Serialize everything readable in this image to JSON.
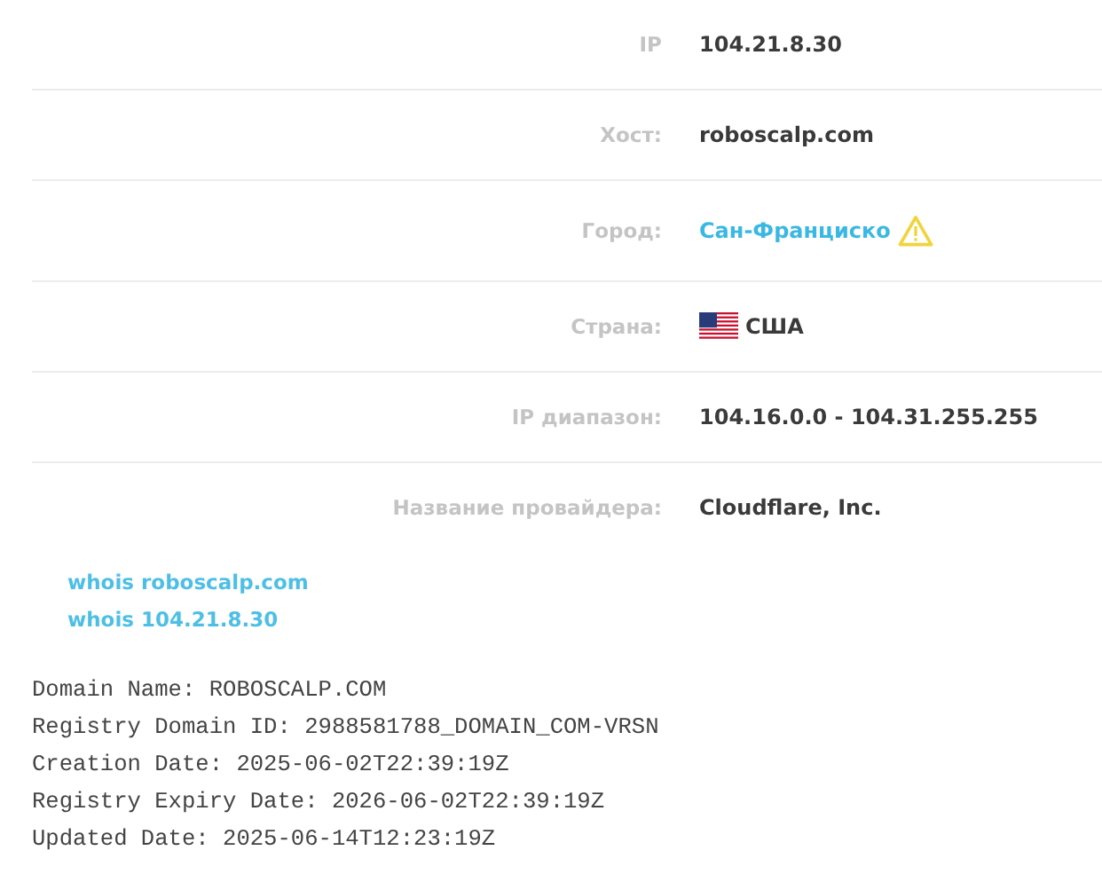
{
  "info_rows": [
    {
      "label": "IP",
      "kind": "text",
      "value": "104.21.8.30"
    },
    {
      "label": "Хост:",
      "kind": "text",
      "value": "roboscalp.com"
    },
    {
      "label": "Город:",
      "kind": "link",
      "value": "Сан-Франциско",
      "warning": true
    },
    {
      "label": "Страна:",
      "kind": "flag",
      "value": "США"
    },
    {
      "label": "IP диапазон:",
      "kind": "text",
      "value": "104.16.0.0 - 104.31.255.255"
    },
    {
      "label": "Название провайдера:",
      "kind": "text",
      "value": "Cloudflare, Inc."
    }
  ],
  "whois_links": [
    "whois roboscalp.com",
    "whois 104.21.8.30"
  ],
  "whois_lines": [
    "Domain Name: ROBOSCALP.COM",
    "Registry Domain ID: 2988581788_DOMAIN_COM-VRSN",
    "Creation Date: 2025-06-02T22:39:19Z",
    "Registry Expiry Date: 2026-06-02T22:39:19Z",
    "Updated Date: 2025-06-14T12:23:19Z"
  ]
}
